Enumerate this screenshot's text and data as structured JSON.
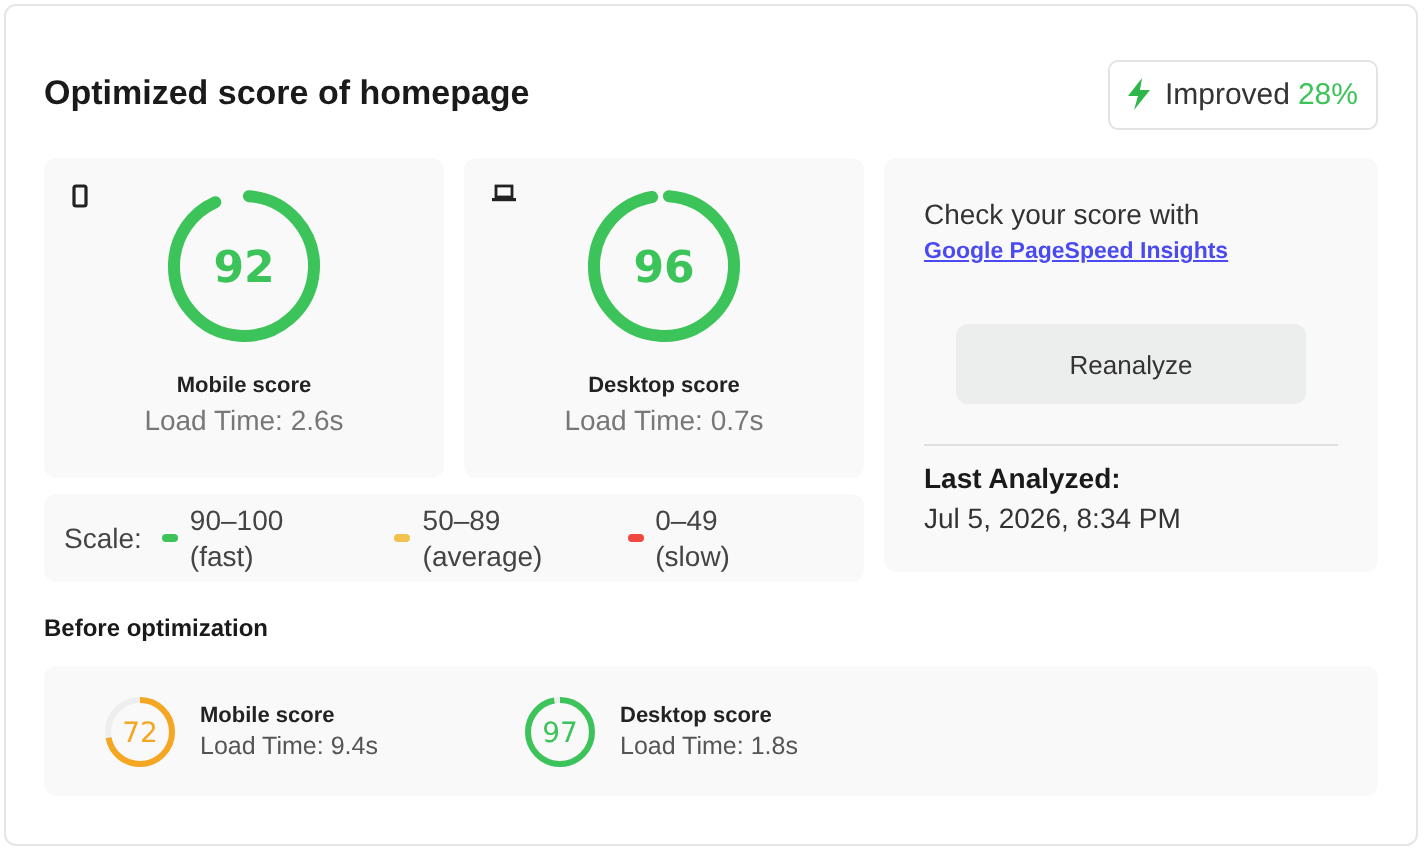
{
  "title": "Optimized score of homepage",
  "badge": {
    "label": "Improved",
    "value": "28%"
  },
  "scores": [
    {
      "kind": "mobile",
      "score": "92",
      "level": 0.92,
      "color": "#3cc35a",
      "label": "Mobile score",
      "load_time": "Load Time: 2.6s"
    },
    {
      "kind": "desktop",
      "score": "96",
      "level": 0.96,
      "color": "#3cc35a",
      "label": "Desktop score",
      "load_time": "Load Time: 0.7s"
    }
  ],
  "scale": {
    "label": "Scale:",
    "items": [
      {
        "range": "90–100",
        "note": "(fast)",
        "color": "#3cc35a"
      },
      {
        "range": "50–89",
        "note": "(average)",
        "color": "#f2c14e"
      },
      {
        "range": "0–49",
        "note": "(slow)",
        "color": "#f0483e"
      }
    ]
  },
  "check": {
    "text": "Check your score with",
    "link": "Google PageSpeed Insights",
    "button": "Reanalyze",
    "last_label": "Last Analyzed:",
    "last_value": "Jul 5, 2026, 8:34 PM"
  },
  "before": {
    "title": "Before optimization",
    "scores": [
      {
        "score": "72",
        "level": 0.72,
        "color": "#f5a623",
        "label": "Mobile score",
        "load_time": "Load Time: 9.4s"
      },
      {
        "score": "97",
        "level": 0.97,
        "color": "#3cc35a",
        "label": "Desktop score",
        "load_time": "Load Time: 1.8s"
      }
    ]
  }
}
